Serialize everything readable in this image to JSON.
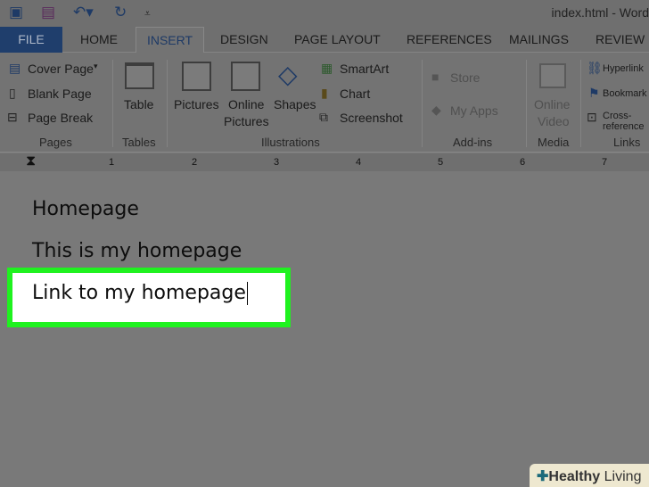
{
  "titlebar": {
    "title": "index.html - Word"
  },
  "tabs": [
    "FILE",
    "HOME",
    "INSERT",
    "DESIGN",
    "PAGE LAYOUT",
    "REFERENCES",
    "MAILINGS",
    "REVIEW"
  ],
  "ribbon": {
    "pages": {
      "cover": "Cover Page",
      "blank": "Blank Page",
      "break": "Page Break",
      "label": "Pages"
    },
    "tables": {
      "table": "Table",
      "label": "Tables"
    },
    "illustrations": {
      "pictures": "Pictures",
      "online1": "Online",
      "online2": "Pictures",
      "shapes": "Shapes",
      "smartart": "SmartArt",
      "chart": "Chart",
      "screenshot": "Screenshot",
      "label": "Illustrations"
    },
    "addins": {
      "store": "Store",
      "myapps": "My Apps",
      "label": "Add-ins"
    },
    "media": {
      "v1": "Online",
      "v2": "Video",
      "label": "Media"
    },
    "links": {
      "hyperlink": "Hyperlink",
      "bookmark": "Bookmark",
      "crossref": "Cross-reference",
      "label": "Links"
    }
  },
  "ruler": [
    "1",
    "2",
    "3",
    "4",
    "5",
    "6",
    "7"
  ],
  "document": {
    "line1": "Homepage",
    "line2": "This is my homepage",
    "line3": "Link to my homepage"
  },
  "watermark": {
    "brand": "Healthy",
    "brand2": "Living"
  },
  "colors": {
    "highlight": "#1ff21f",
    "file_tab": "#1f3e6c"
  }
}
